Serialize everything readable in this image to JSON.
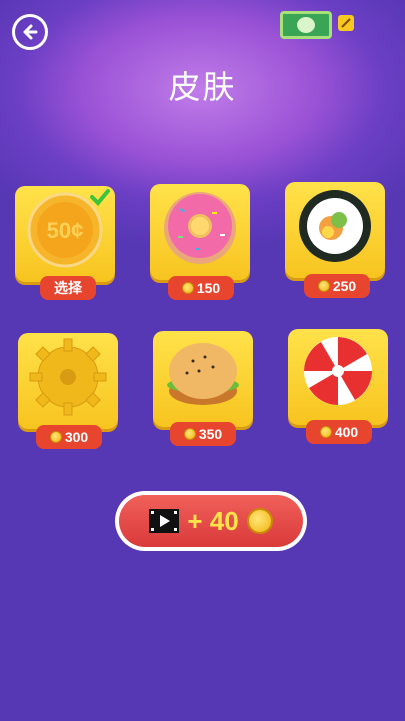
{
  "header": {
    "title": "皮肤"
  },
  "skins": [
    {
      "id": "coin50",
      "art_label": "50¢",
      "status_label": "选择",
      "selected": true
    },
    {
      "id": "donut",
      "price": "150"
    },
    {
      "id": "sushi",
      "price": "250"
    },
    {
      "id": "gear",
      "price": "300"
    },
    {
      "id": "burger",
      "price": "350"
    },
    {
      "id": "candy",
      "price": "400"
    }
  ],
  "reward_button": {
    "label": "+ 40"
  },
  "colors": {
    "background": "#6c3fc4",
    "card": "#f7c41f",
    "price_badge": "#e8452f",
    "reward_button": "#d93a3a",
    "reward_text": "#ffe34a"
  }
}
